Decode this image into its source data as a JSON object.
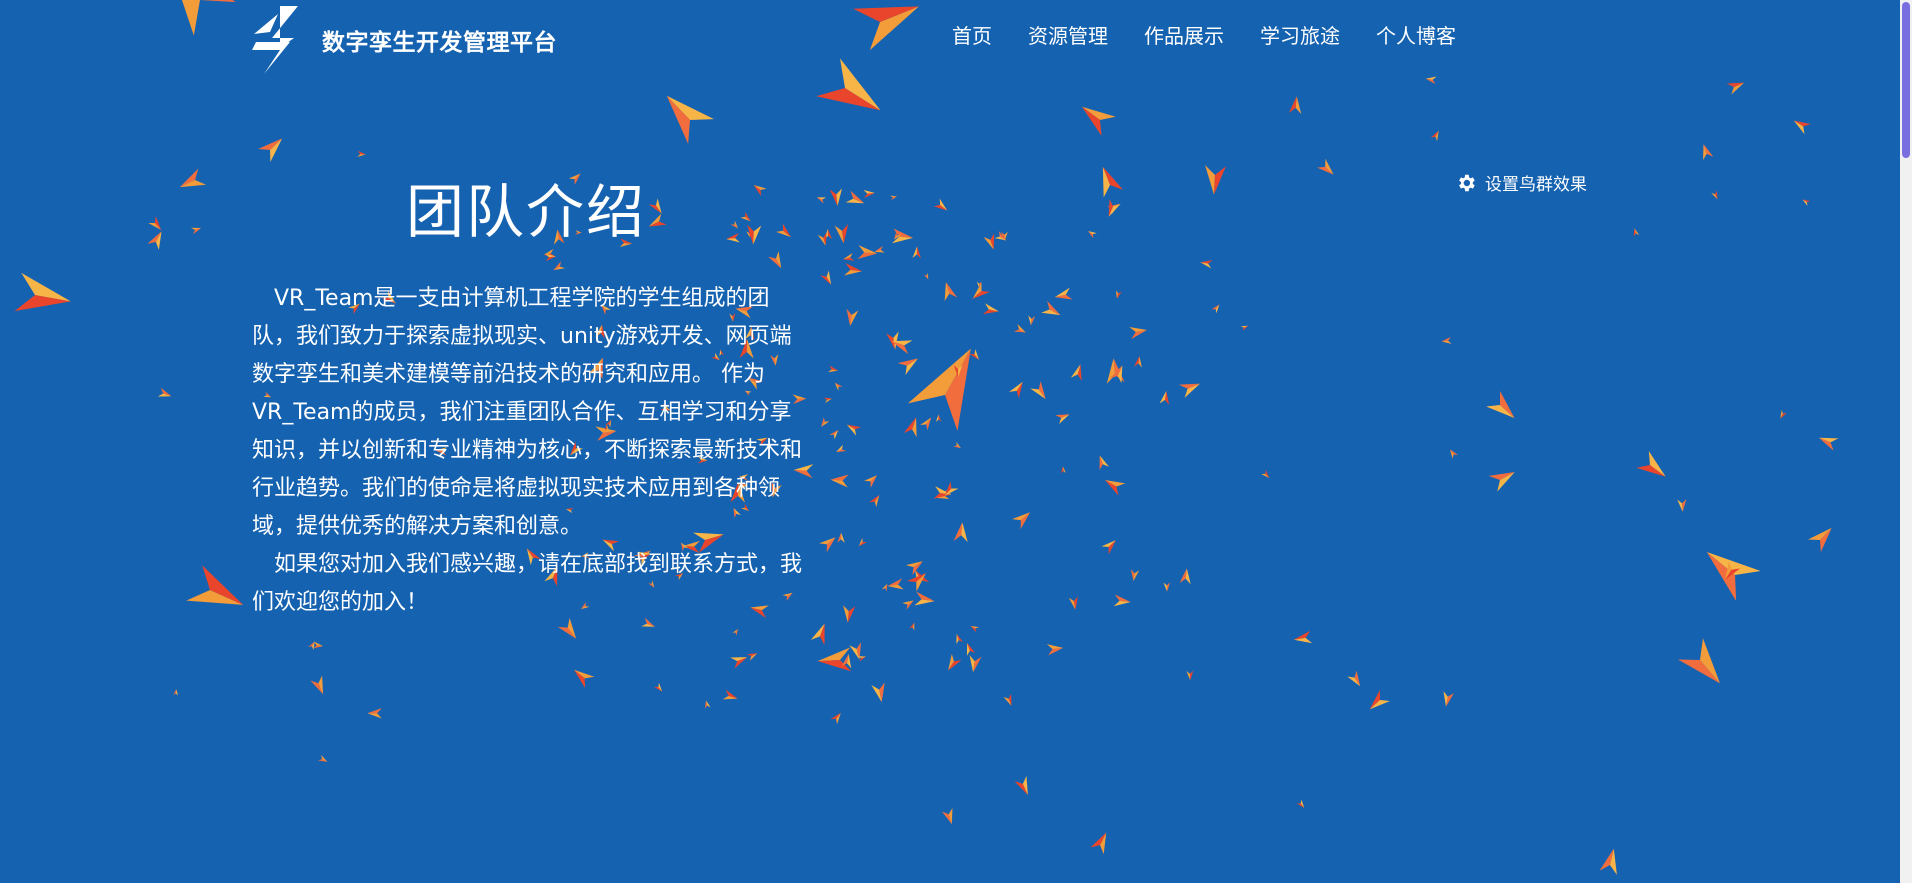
{
  "brand": {
    "title": "数字孪生开发管理平台",
    "logo_icon": "lightning-bolt-icon"
  },
  "nav": {
    "items": [
      {
        "label": "首页"
      },
      {
        "label": "资源管理"
      },
      {
        "label": "作品展示"
      },
      {
        "label": "学习旅途"
      },
      {
        "label": "个人博客"
      }
    ]
  },
  "settings": {
    "label": "设置鸟群效果",
    "icon": "gear-icon"
  },
  "main": {
    "title": "团队介绍",
    "paragraphs": [
      "VR_Team是一支由计算机工程学院的学生组成的团队，我们致力于探索虚拟现实、unity游戏开发、网页端数字孪生和美术建模等前沿技术的研究和应用。 作为VR_Team的成员，我们注重团队合作、互相学习和分享知识，并以创新和专业精神为核心，不断探索最新技术和行业趋势。我们的使命是将虚拟现实技术应用到各种领域，提供优秀的解决方案和创意。",
      "如果您对加入我们感兴趣，请在底部找到联系方式，我们欢迎您的加入！"
    ]
  },
  "theme": {
    "background": "#1562b0",
    "bird_colors": [
      "#f26d3d",
      "#f39c3a",
      "#e8452c",
      "#f7b548"
    ]
  }
}
